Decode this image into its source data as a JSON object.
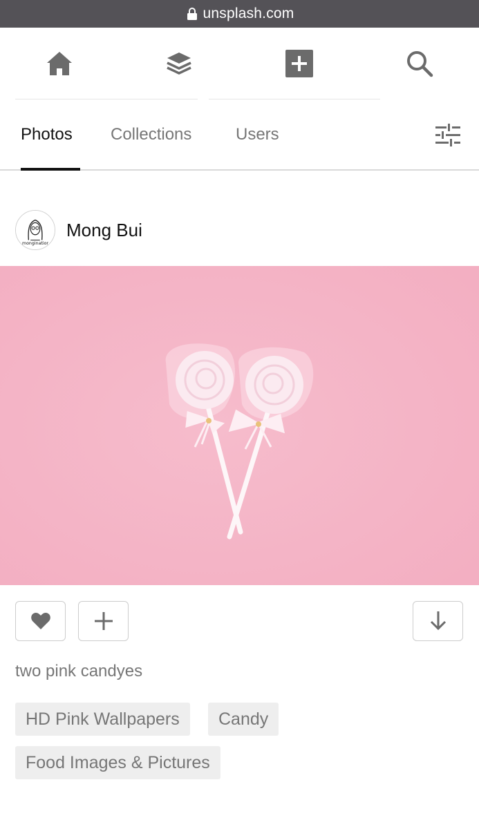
{
  "browser": {
    "domain": "unsplash.com",
    "lock_icon": "lock-icon"
  },
  "top_nav": {
    "icons": [
      "home-icon",
      "collections-stack-icon",
      "add-photo-icon",
      "search-icon"
    ]
  },
  "tabs": [
    {
      "label": "Photos",
      "active": true
    },
    {
      "label": "Collections",
      "active": false
    },
    {
      "label": "Users",
      "active": false
    }
  ],
  "filter_icon": "filter-sliders-icon",
  "post": {
    "author_name": "Mong Bui",
    "avatar_text": "monginatior",
    "photo_subject": "two pink candyes",
    "photo_colors": {
      "background": "#f5b6c8",
      "candy": "#fbeaf0"
    },
    "actions": [
      "heart-icon",
      "plus-icon",
      "download-arrow-icon"
    ],
    "description": "two pink candyes",
    "tags": [
      "HD Pink Wallpapers",
      "Candy",
      "Food Images & Pictures"
    ]
  }
}
